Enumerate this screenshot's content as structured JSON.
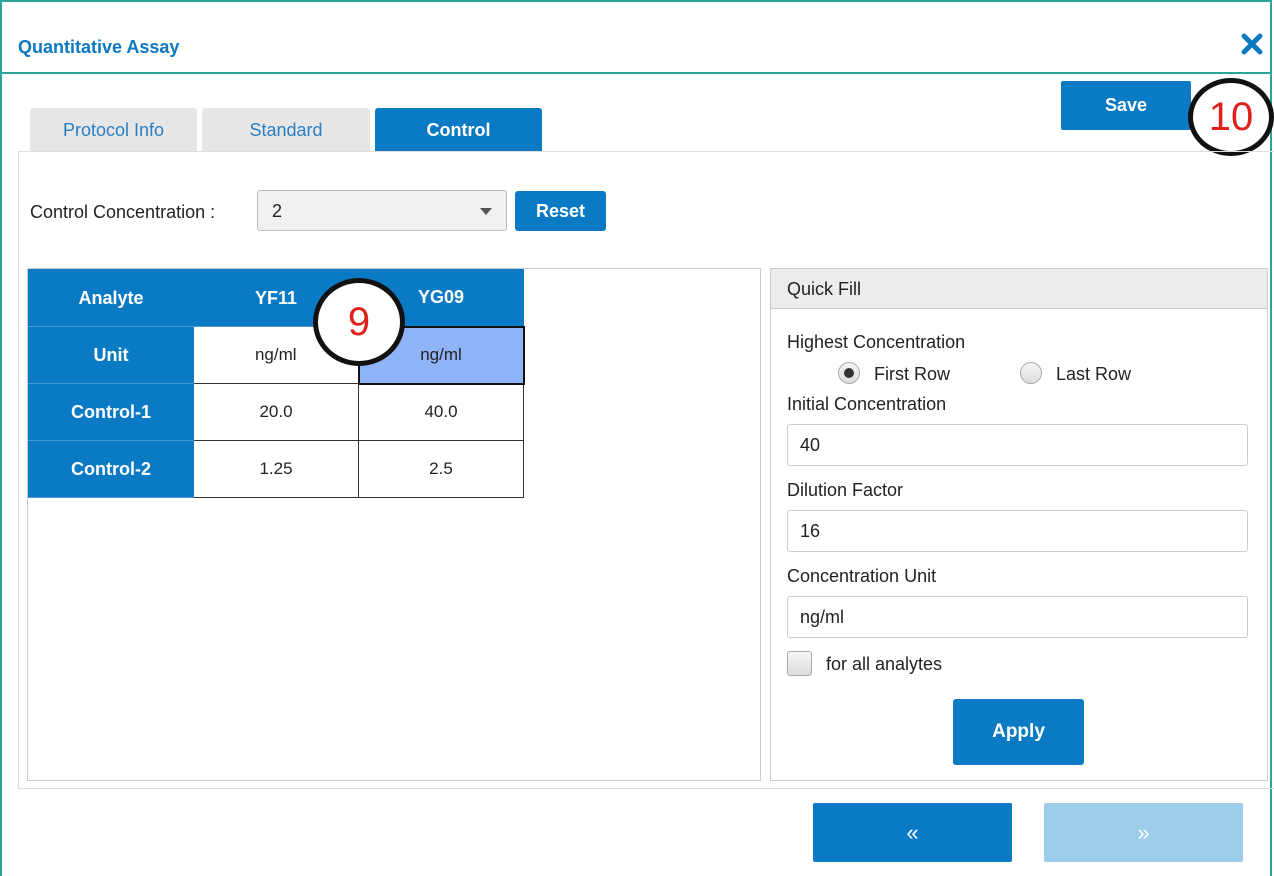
{
  "dialog": {
    "title": "Quantitative Assay",
    "close_icon": "close-icon"
  },
  "toolbar": {
    "save_label": "Save"
  },
  "callouts": {
    "save": "10",
    "grid": "9"
  },
  "tabs": [
    {
      "label": "Protocol Info",
      "active": false
    },
    {
      "label": "Standard",
      "active": false
    },
    {
      "label": "Control",
      "active": true
    }
  ],
  "control_concentration": {
    "label": "Control Concentration :",
    "selected": "2",
    "reset_label": "Reset"
  },
  "grid": {
    "corner": "Analyte",
    "columns": [
      "YF11",
      "YG09"
    ],
    "rows": [
      {
        "label": "Unit",
        "values": [
          "ng/ml",
          "ng/ml"
        ]
      },
      {
        "label": "Control-1",
        "values": [
          "20.0",
          "40.0"
        ]
      },
      {
        "label": "Control-2",
        "values": [
          "1.25",
          "2.5"
        ]
      }
    ]
  },
  "quick_fill": {
    "title": "Quick Fill",
    "highest_concentration_label": "Highest Concentration",
    "radio_first_row": "First Row",
    "radio_last_row": "Last Row",
    "radio_selected": "First Row",
    "initial_concentration_label": "Initial Concentration",
    "initial_concentration_value": "40",
    "dilution_factor_label": "Dilution Factor",
    "dilution_factor_value": "16",
    "concentration_unit_label": "Concentration Unit",
    "concentration_unit_value": "ng/ml",
    "for_all_analytes_label": "for all analytes",
    "for_all_analytes_checked": false,
    "apply_label": "Apply"
  },
  "nav": {
    "prev_label": "«",
    "next_label": "»"
  },
  "colors": {
    "accent": "#0b7ac4",
    "border_teal": "#2aa59a",
    "selected_cell": "#8fb3f7",
    "disabled_nav": "#9dcbea",
    "callout_text": "#e0211c"
  }
}
